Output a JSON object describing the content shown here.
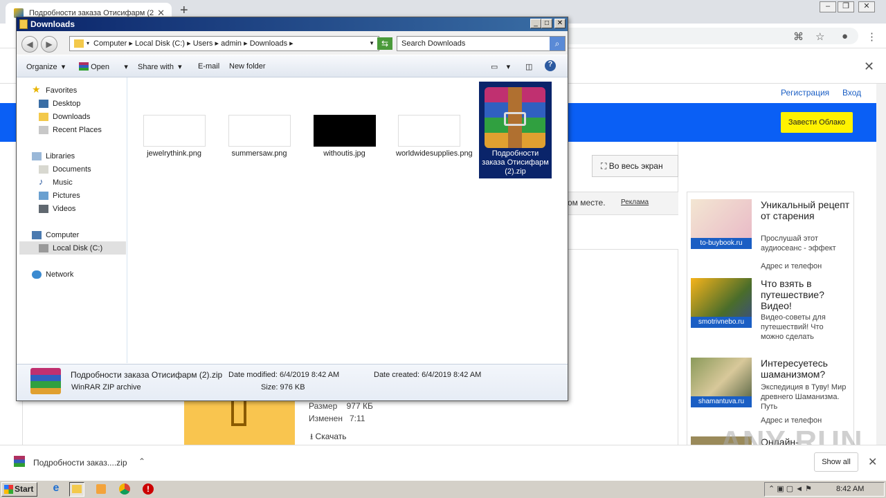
{
  "browser": {
    "tab_title": "Подробности заказа Отисифарм (2",
    "new_tab": "+",
    "page_links": {
      "register": "Регистрация",
      "login": "Вход"
    },
    "cloud_button": "Завести Облако",
    "fullscreen_button": "Во весь экран",
    "ad_text": "ом месте.",
    "ad_label": "Реклама",
    "file_meta": {
      "size_label": "Размер",
      "size_value": "977 КБ",
      "modified_label": "Изменен",
      "modified_value": "7:11"
    },
    "download_link": "Скачать",
    "ads": [
      {
        "source": "to-buybook.ru",
        "headline": "Уникальный рецепт от старения",
        "desc": "Прослушай этот аудиосеанс - эффект",
        "contact": "Адрес и телефон"
      },
      {
        "source": "smotrivnebo.ru",
        "headline": "Что взять в путешествие? Видео!",
        "desc": "Видео-советы для путешествий! Что можно сделать",
        "contact": ""
      },
      {
        "source": "shamantuva.ru",
        "headline": "Интересуетесь шаманизмом?",
        "desc": "Экспедиция в Туву! Мир древнего Шаманизма. Путь",
        "contact": "Адрес и телефон"
      },
      {
        "source": "",
        "headline": "Онлайн-",
        "desc": "",
        "contact": ""
      }
    ],
    "shelf": {
      "file": "Подробности заказ....zip",
      "show_all": "Show all"
    }
  },
  "explorer": {
    "title": "Downloads",
    "breadcrumb": [
      "Computer",
      "Local Disk (C:)",
      "Users",
      "admin",
      "Downloads"
    ],
    "search_placeholder": "Search Downloads",
    "commands": {
      "organize": "Organize",
      "open": "Open",
      "share": "Share with",
      "email": "E-mail",
      "new_folder": "New folder"
    },
    "nav": {
      "favorites": "Favorites",
      "desktop": "Desktop",
      "downloads": "Downloads",
      "recent": "Recent Places",
      "libraries": "Libraries",
      "documents": "Documents",
      "music": "Music",
      "pictures": "Pictures",
      "videos": "Videos",
      "computer": "Computer",
      "localdisk": "Local Disk (C:)",
      "network": "Network"
    },
    "files": [
      {
        "name": "jewelrythink.png"
      },
      {
        "name": "summersaw.png"
      },
      {
        "name": "withoutis.jpg"
      },
      {
        "name": "worldwidesupplies.png"
      },
      {
        "name": "Подробности заказа Отисифарм (2).zip"
      }
    ],
    "details": {
      "name": "Подробности заказа Отисифарм (2).zip",
      "type": "WinRAR ZIP archive",
      "modified": "Date modified: 6/4/2019 8:42 AM",
      "created": "Date created: 6/4/2019 8:42 AM",
      "size": "Size: 976 KB"
    }
  },
  "taskbar": {
    "start": "Start",
    "clock": "8:42 AM"
  },
  "watermark": "ANY RUN"
}
